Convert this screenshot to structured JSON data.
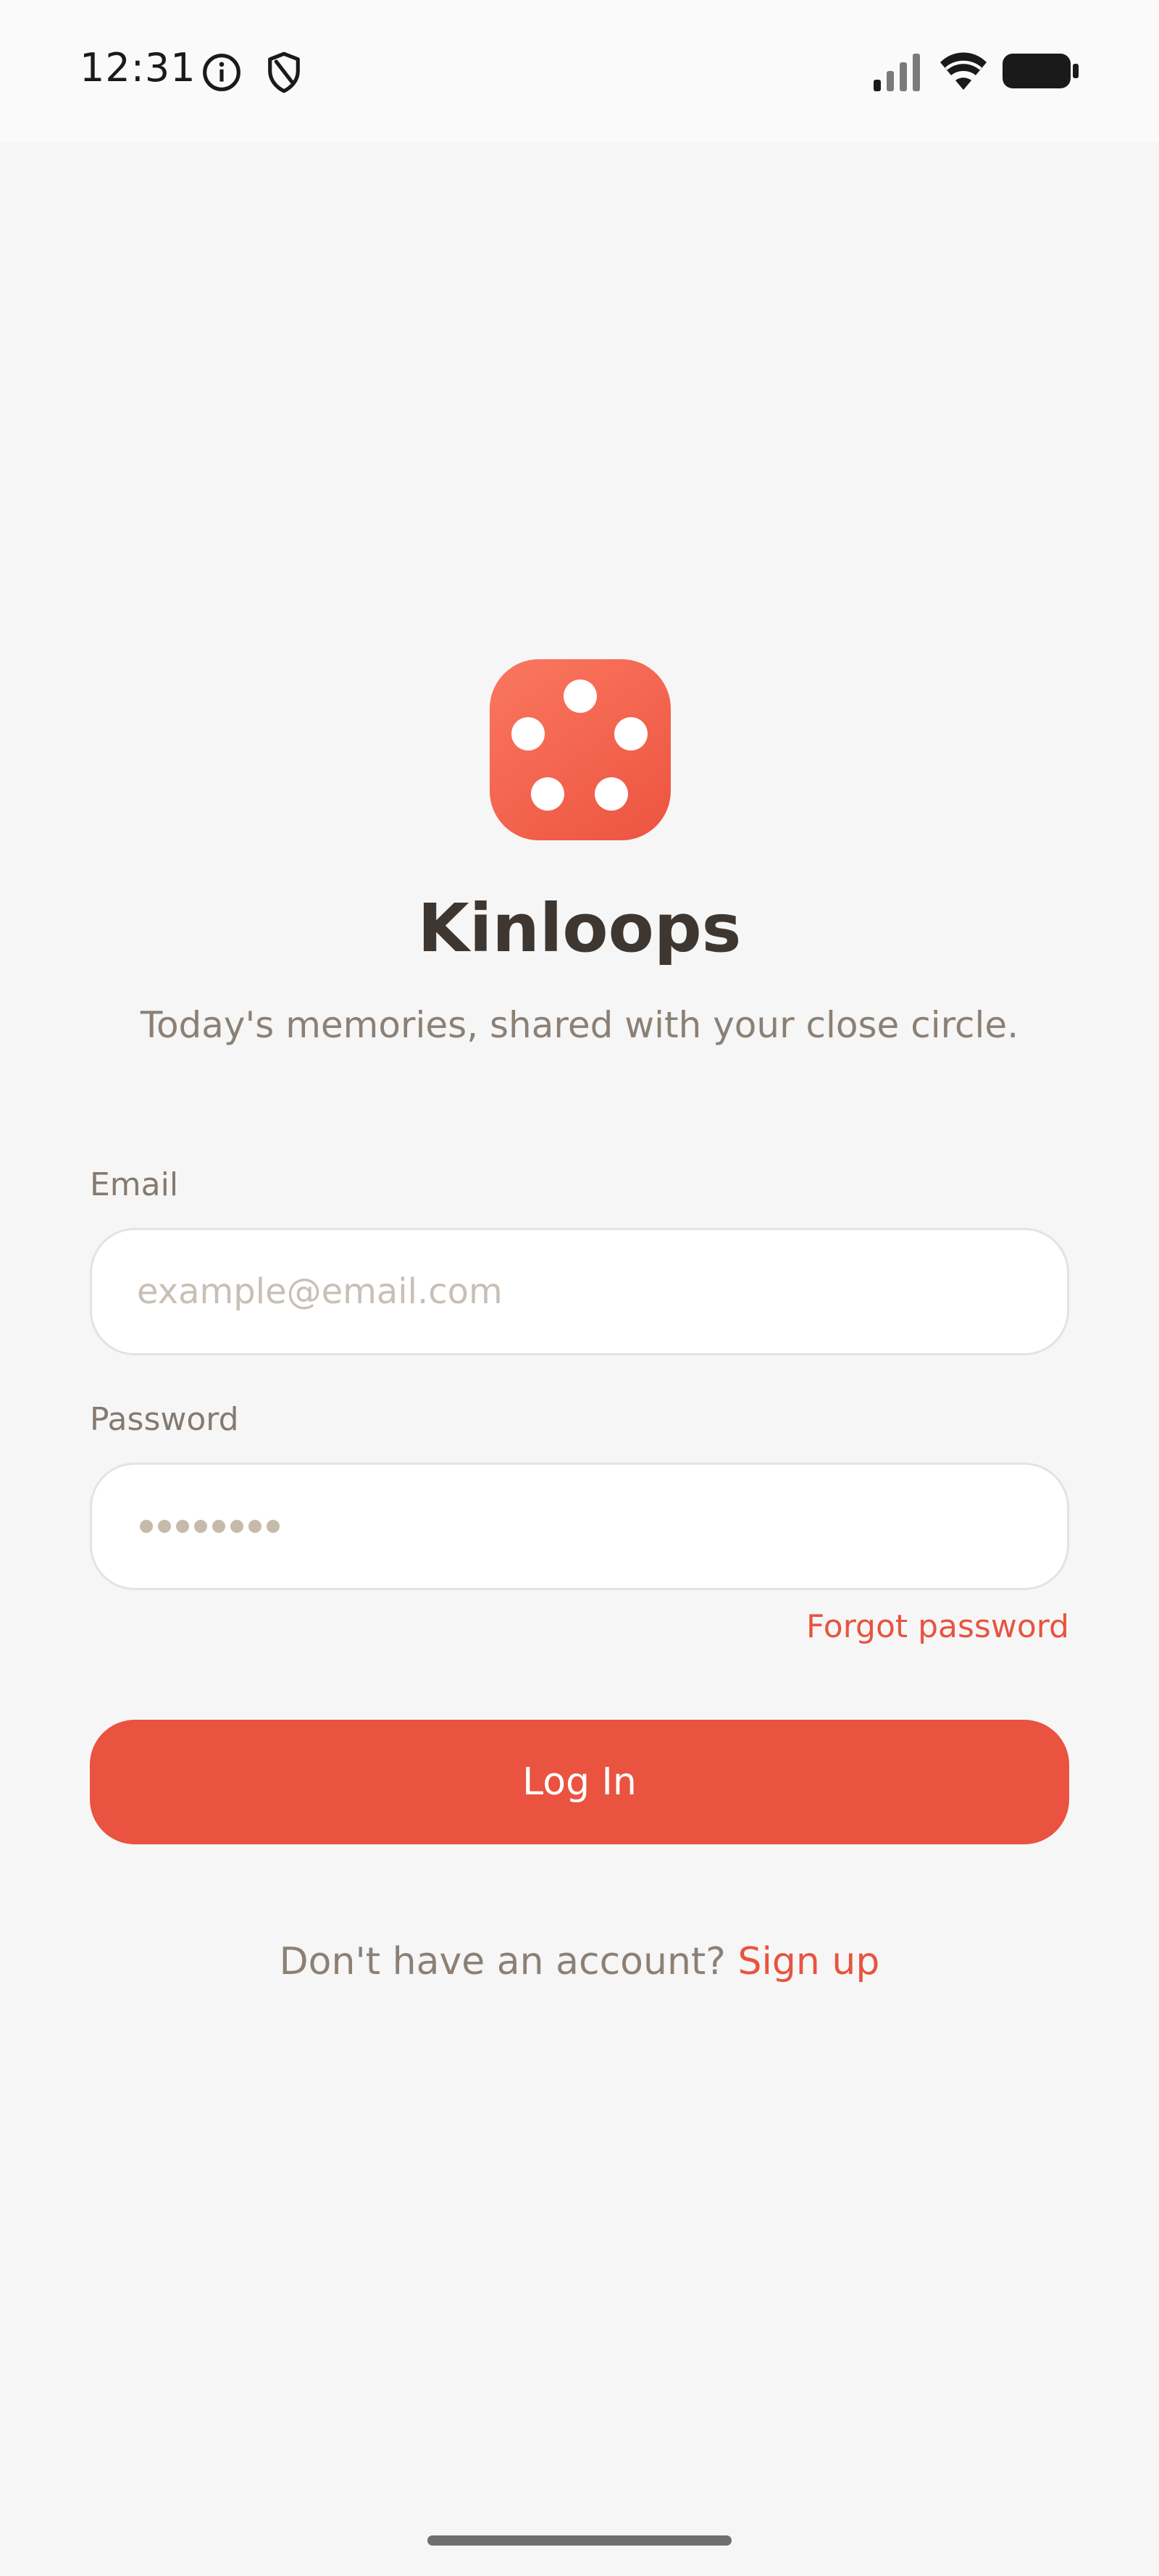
{
  "status_bar": {
    "time": "12:31",
    "icons": [
      "info-icon",
      "shield-icon",
      "signal-icon",
      "wifi-icon",
      "battery-icon"
    ]
  },
  "brand": {
    "logo_icon": "dice-dots-icon",
    "app_name": "Kinloops",
    "tagline": "Today's memories, shared with your close circle.",
    "accent_color": "#e9533f"
  },
  "form": {
    "email_label": "Email",
    "email_placeholder": "example@email.com",
    "email_value": "",
    "password_label": "Password",
    "password_value_masked": "••••••••",
    "forgot_password": "Forgot password",
    "login_label": "Log In"
  },
  "footer": {
    "signup_prompt": "Don't have an account?",
    "signup_link": "Sign up"
  }
}
